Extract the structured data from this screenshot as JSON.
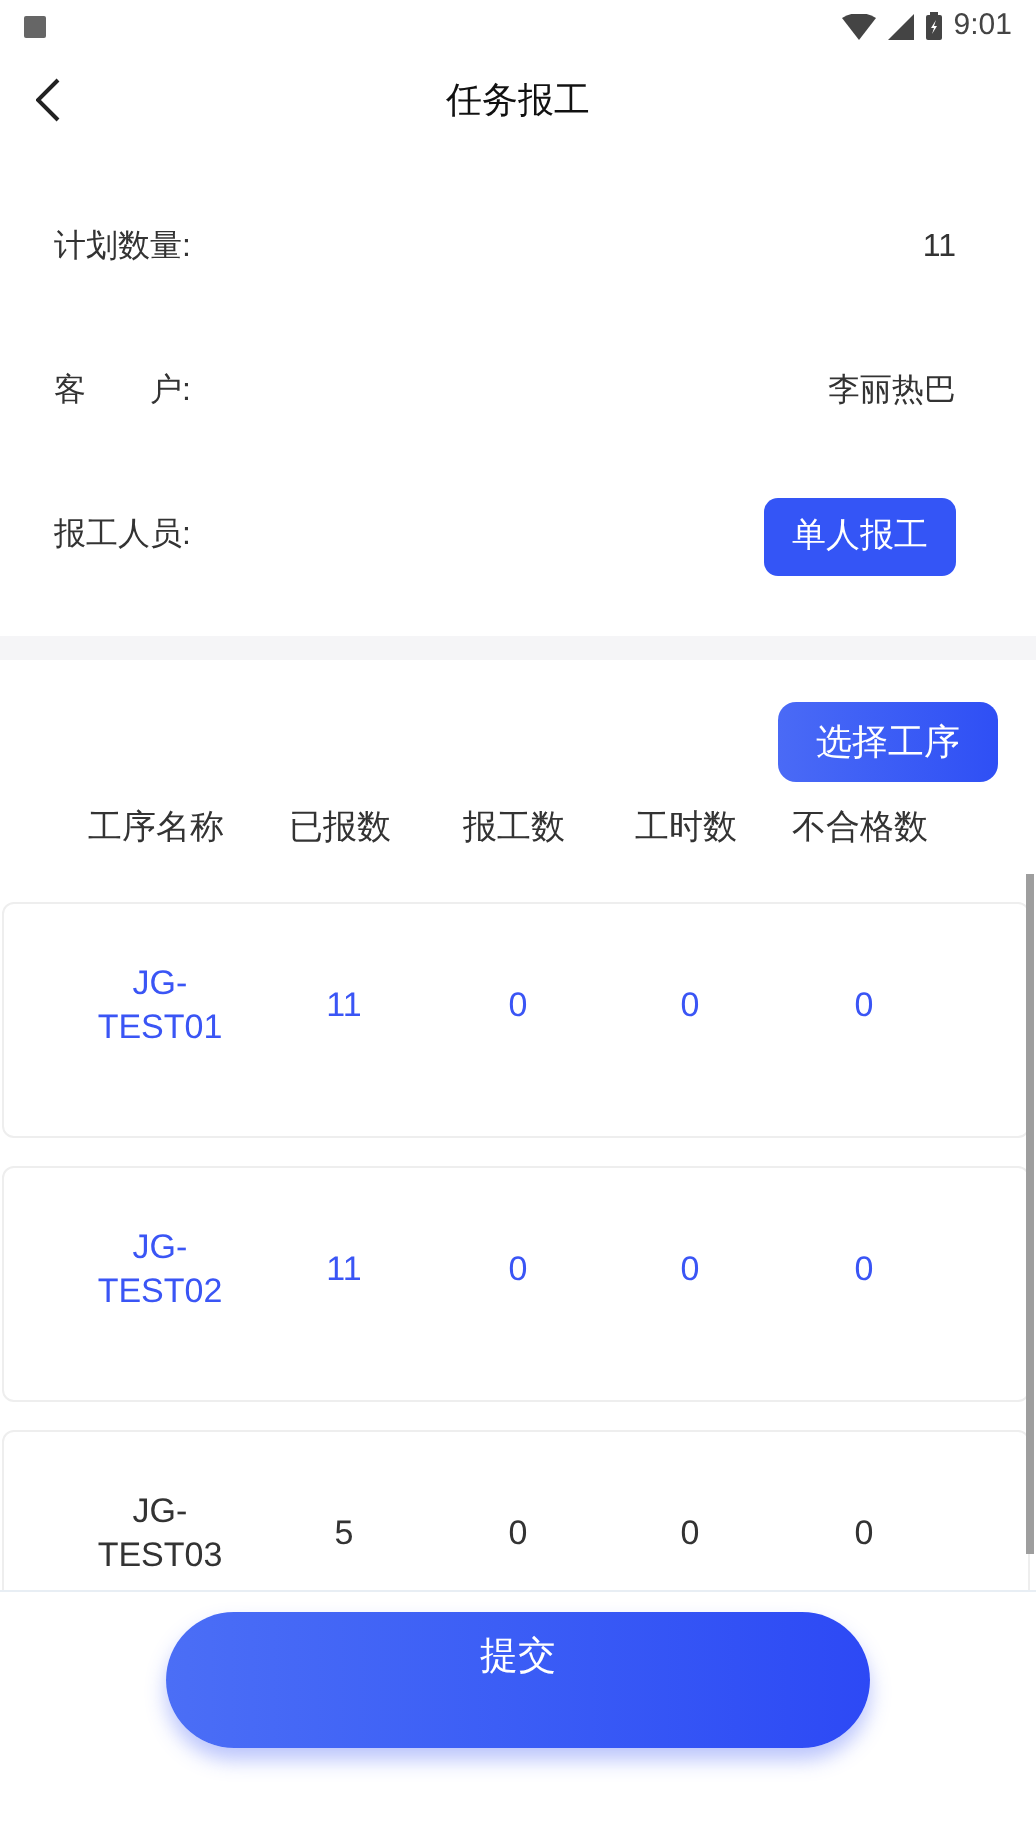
{
  "status_bar": {
    "time": "9:01"
  },
  "header": {
    "title": "任务报工"
  },
  "info": [
    {
      "kind": "value",
      "label": "计划数量:",
      "value": "11"
    },
    {
      "kind": "value",
      "label": "客　　户:",
      "value": "李丽热巴"
    },
    {
      "kind": "button",
      "label": "报工人员:",
      "value": "单人报工"
    }
  ],
  "select_button": "选择工序",
  "table": {
    "columns": [
      "工序名称",
      "已报数",
      "报工数",
      "工时数",
      "不合格数"
    ],
    "rows": [
      {
        "cells": [
          "JG-TEST01",
          "11",
          "0",
          "0",
          "0"
        ],
        "selected": true
      },
      {
        "cells": [
          "JG-TEST02",
          "11",
          "0",
          "0",
          "0"
        ],
        "selected": true
      },
      {
        "cells": [
          "JG-TEST03",
          "5",
          "0",
          "0",
          "0"
        ],
        "selected": false
      }
    ]
  },
  "submit_button": "提交"
}
